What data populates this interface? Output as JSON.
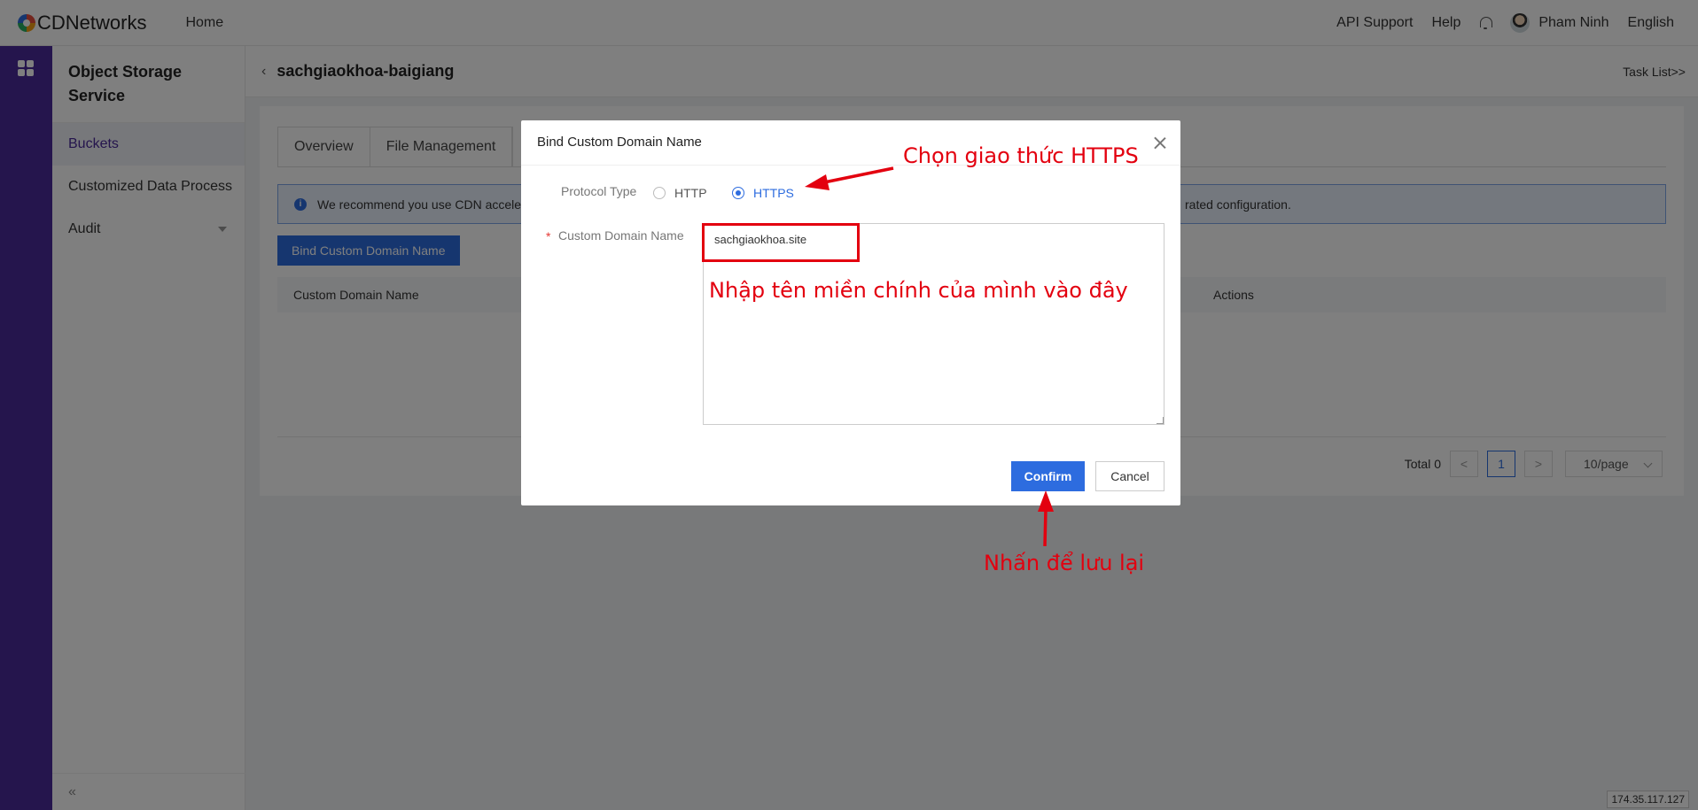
{
  "header": {
    "logo_text": "CDNetworks",
    "home": "Home",
    "api_support": "API Support",
    "help": "Help",
    "user_name": "Pham Ninh",
    "language": "English"
  },
  "sidebar": {
    "title": "Object Storage Service",
    "items": [
      {
        "label": "Buckets",
        "active": true
      },
      {
        "label": "Customized Data Process",
        "active": false
      },
      {
        "label": "Audit",
        "active": false
      }
    ],
    "collapse_glyph": "«"
  },
  "page": {
    "back_glyph": "‹",
    "bucket_name": "sachgiaokhoa-baigiang",
    "task_list": "Task List>>",
    "tabs": [
      "Overview",
      "File Management"
    ],
    "notice_start": "We recommend you use CDN accele",
    "notice_end": "rated configuration.",
    "bind_button": "Bind Custom Domain Name",
    "table_headers": {
      "domain": "Custom Domain Name",
      "actions": "Actions"
    },
    "pager": {
      "total": "Total 0",
      "prev": "<",
      "current": "1",
      "next": ">",
      "page_size": "10/page"
    },
    "ip": "174.35.117.127"
  },
  "modal": {
    "title": "Bind Custom Domain Name",
    "protocol_label": "Protocol Type",
    "protocol_options": [
      "HTTP",
      "HTTPS"
    ],
    "protocol_selected": "HTTPS",
    "required_mark": "*",
    "domain_label": "Custom Domain Name",
    "domain_value": "sachgiaokhoa.site",
    "confirm": "Confirm",
    "cancel": "Cancel"
  },
  "annotations": {
    "choose_https": "Chọn giao thức HTTPS",
    "enter_domain": "Nhập tên miền chính của mình vào đây",
    "click_save": "Nhấn để lưu lại",
    "color": "#e3000f"
  },
  "colors": {
    "brand_purple": "#4a2a9a",
    "primary_blue": "#2d6cdf"
  }
}
